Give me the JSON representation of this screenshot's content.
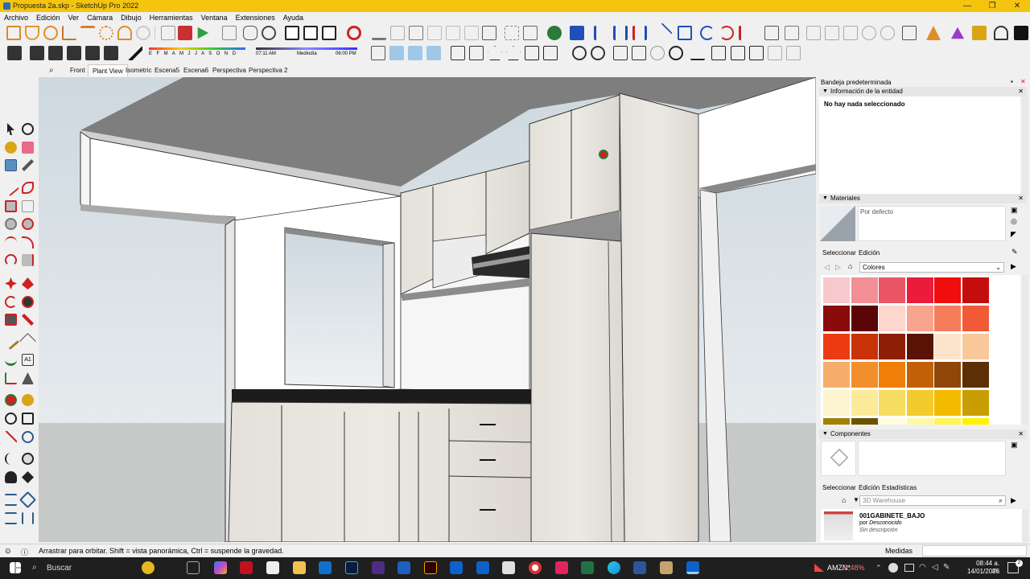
{
  "window": {
    "title": "Propuesta 2a.skp - SketchUp Pro 2022",
    "minimize": "—",
    "maximize": "❐",
    "close": "✕"
  },
  "menu": [
    "Archivo",
    "Edición",
    "Ver",
    "Cámara",
    "Dibujo",
    "Herramientas",
    "Ventana",
    "Extensiones",
    "Ayuda"
  ],
  "shadow": {
    "months": [
      "E",
      "F",
      "M",
      "A",
      "M",
      "J",
      "J",
      "A",
      "S",
      "O",
      "N",
      "D"
    ],
    "time_start": "07:11 AM",
    "time_mid": "Mediodía",
    "time_end": "06:00 PM"
  },
  "scenes": [
    {
      "label": "Front",
      "active": false
    },
    {
      "label": "Plant View",
      "active": true
    },
    {
      "label": "Isometric",
      "active": false
    },
    {
      "label": "Escena5",
      "active": false
    },
    {
      "label": "Escena6",
      "active": false
    },
    {
      "label": "Perspectiva",
      "active": false
    },
    {
      "label": "Perspectiva 2",
      "active": false
    }
  ],
  "tray": {
    "title": "Bandeja predeterminada",
    "entity": {
      "header": "Información de la entidad",
      "message": "No hay nada seleccionado"
    },
    "materials": {
      "header": "Materiales",
      "current": "Por defecto",
      "tab_select": "Seleccionar",
      "tab_edit": "Edición",
      "library": "Colores",
      "swatches": [
        "#f7c8cc",
        "#f28e96",
        "#ea5565",
        "#ea1b3b",
        "#f00d0d",
        "#c40e0e",
        "#8a0b0b",
        "#5a0505",
        "#fdd7cd",
        "#f8a48e",
        "#f57d5c",
        "#f05a37",
        "#ee3a12",
        "#c83208",
        "#8f1e07",
        "#5a1205",
        "#fce4cc",
        "#f9c89a",
        "#f6ad6a",
        "#f28f2c",
        "#ef7f08",
        "#c16007",
        "#8f4608",
        "#5e2e05",
        "#fdf4d0",
        "#faea9a",
        "#f7dc62",
        "#f4cb2c",
        "#f2bb00",
        "#c99e04",
        "#a38100",
        "#6b5400",
        "#fffbe0",
        "#fffaa0",
        "#fff55a",
        "#fff200"
      ]
    },
    "components": {
      "header": "Componentes",
      "tab_select": "Seleccionar",
      "tab_edit": "Edición",
      "tab_stats": "Estadísticas",
      "search_placeholder": "3D Warehouse",
      "item_name": "001GABINETE_BAJO",
      "item_by_label": "por",
      "item_author": "Desconocido",
      "item_desc": "Sin descripción"
    }
  },
  "status": {
    "message": "Arrastrar para orbitar. Shift = vista panorámica, Ctrl = suspende la gravedad.",
    "measure_label": "Medidas"
  },
  "taskbar": {
    "search": "Buscar",
    "stock_name": "AMZN*",
    "stock_change": "-2,48%",
    "time": "08:44 a. m.",
    "date": "14/01/2026",
    "notification_count": "2"
  }
}
